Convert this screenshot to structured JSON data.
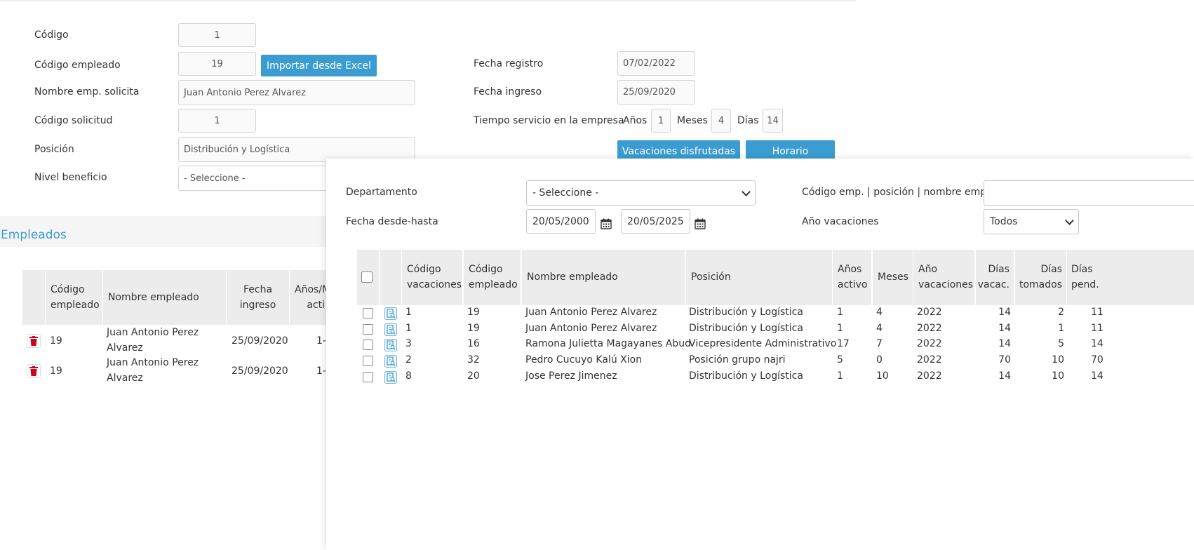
{
  "form": {
    "codigo_label": "Código",
    "codigo_value": "1",
    "codigo_empleado_label": "Código empleado",
    "codigo_empleado_value": "19",
    "importar_button": "Importar desde Excel",
    "nombre_label": "Nombre emp. solicita",
    "nombre_value": "Juan Antonio Perez Alvarez",
    "codigo_solicitud_label": "Código solicitud",
    "codigo_solicitud_value": "1",
    "posicion_label": "Posición",
    "posicion_value": "Distribución y Logística",
    "nivel_label": "Nivel beneficio",
    "nivel_value": "- Seleccione -",
    "fecha_registro_label": "Fecha registro",
    "fecha_registro_value": "07/02/2022",
    "fecha_ingreso_label": "Fecha ingreso",
    "fecha_ingreso_value": "25/09/2020",
    "tiempo_label": "Tiempo servicio en la empresa",
    "anos_label": "Años",
    "anos_value": "1",
    "meses_label": "Meses",
    "meses_value": "4",
    "dias_label": "Días",
    "dias_value": "14",
    "vacaciones_button": "Vacaciones disfrutadas",
    "horario_button": "Horario"
  },
  "empleados": {
    "title": "Empleados",
    "headers": [
      "Código\nempleado",
      "Nombre empleado",
      "Fecha\ningreso",
      "Años/M\nacti"
    ],
    "rows": [
      {
        "codigo": "19",
        "nombre1": "Juan Antonio Perez",
        "nombre2": "Alvarez",
        "fecha": "25/09/2020",
        "anos": "1-"
      },
      {
        "codigo": "19",
        "nombre1": "Juan Antonio Perez",
        "nombre2": "Alvarez",
        "fecha": "25/09/2020",
        "anos": "1-"
      }
    ]
  },
  "modal": {
    "departamento_label": "Departamento",
    "departamento_value": "- Seleccione -",
    "codigo_emp_label": "Código emp. | posición | nombre emp.",
    "codigo_emp_value": "",
    "fecha_label": "Fecha desde-hasta",
    "fecha_desde": "20/05/2000",
    "fecha_hasta": "20/05/2025",
    "ano_label": "Año vacaciones",
    "ano_value": "Todos",
    "headers": {
      "codigo_vac_1": "Código",
      "codigo_vac_2": "vacaciones",
      "codigo_emp_1": "Código",
      "codigo_emp_2": "empleado",
      "nombre": "Nombre empleado",
      "posicion": "Posición",
      "anos_1": "Años",
      "anos_2": "activo",
      "meses": "Meses",
      "ano_vac_1": "Año",
      "ano_vac_2": "vacaciones",
      "dias_vac_1": "Días",
      "dias_vac_2": "vacac.",
      "dias_tom_1": "Días",
      "dias_tom_2": "tomados",
      "dias_pen_1": "Días",
      "dias_pen_2": "pend."
    },
    "rows": [
      {
        "cv": "1",
        "ce": "19",
        "nombre": "Juan Antonio Perez Alvarez",
        "posicion": "Distribución y Logística",
        "anos": "1",
        "meses": "4",
        "ano": "2022",
        "dv": "14",
        "dt": "2",
        "dp": "11"
      },
      {
        "cv": "1",
        "ce": "19",
        "nombre": "Juan Antonio Perez Alvarez",
        "posicion": "Distribución y Logística",
        "anos": "1",
        "meses": "4",
        "ano": "2022",
        "dv": "14",
        "dt": "1",
        "dp": "11"
      },
      {
        "cv": "3",
        "ce": "16",
        "nombre": "Ramona Julietta Magayanes Abud",
        "posicion": "Vicepresidente Administrativo",
        "anos": "17",
        "meses": "7",
        "ano": "2022",
        "dv": "14",
        "dt": "5",
        "dp": "14"
      },
      {
        "cv": "2",
        "ce": "32",
        "nombre": "Pedro Cucuyo Kalú Xion",
        "posicion": "Posición grupo najri",
        "anos": "5",
        "meses": "0",
        "ano": "2022",
        "dv": "70",
        "dt": "10",
        "dp": "70"
      },
      {
        "cv": "8",
        "ce": "20",
        "nombre": "Jose Perez Jimenez",
        "posicion": "Distribución y Logística",
        "anos": "1",
        "meses": "10",
        "ano": "2022",
        "dv": "14",
        "dt": "10",
        "dp": "14"
      }
    ]
  },
  "colors": {
    "accent": "#3a9cd0",
    "section_title": "#3a9cd0",
    "delete_icon": "#d0021b"
  }
}
